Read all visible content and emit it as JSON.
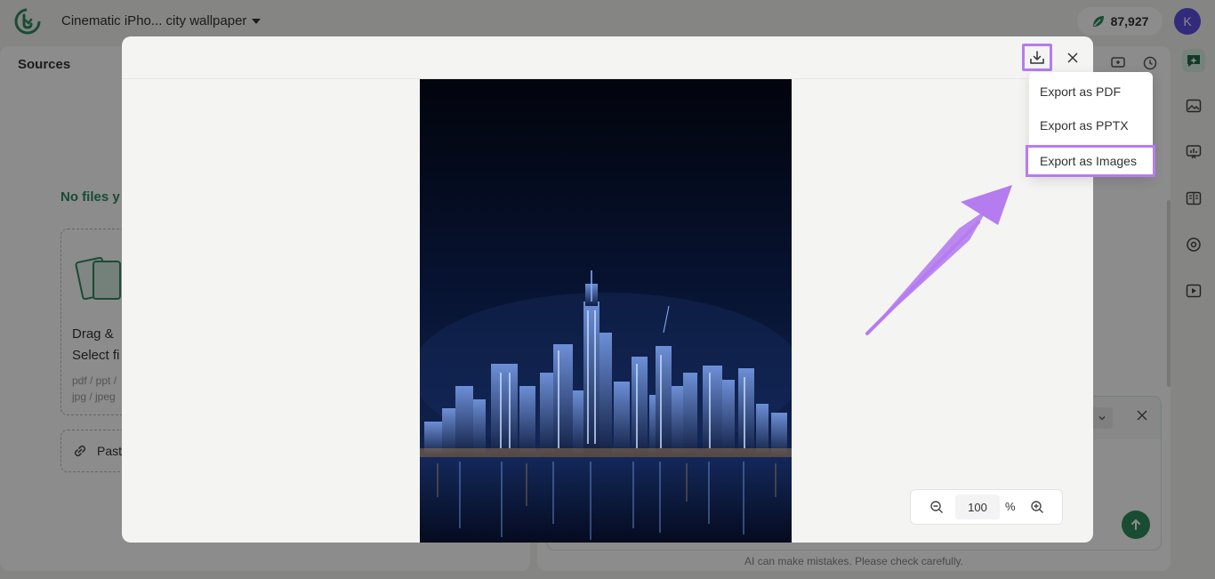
{
  "app": {
    "doc_title": "Cinematic iPho... city wallpaper",
    "credits": "87,927",
    "avatar_initial": "K"
  },
  "sources": {
    "title": "Sources",
    "empty_title": "No files y",
    "drop_line1": "Drag &",
    "drop_line2": "Select fi",
    "formats_line1": "pdf / ppt /",
    "formats_line2": "jpg / jpeg",
    "paste_label": "Paste"
  },
  "chat": {
    "disclaimer": "AI can make mistakes. Please check carefully."
  },
  "modal": {
    "zoom_value": "100",
    "zoom_unit": "%"
  },
  "export_menu": {
    "items": [
      {
        "label": "Export as PDF"
      },
      {
        "label": "Export as PPTX"
      },
      {
        "label": "Export as Images"
      }
    ],
    "highlighted_index": 2
  },
  "colors": {
    "brand_green": "#2f8a5e",
    "highlight_purple": "#b57cf0",
    "avatar_bg": "#5b4de0"
  }
}
